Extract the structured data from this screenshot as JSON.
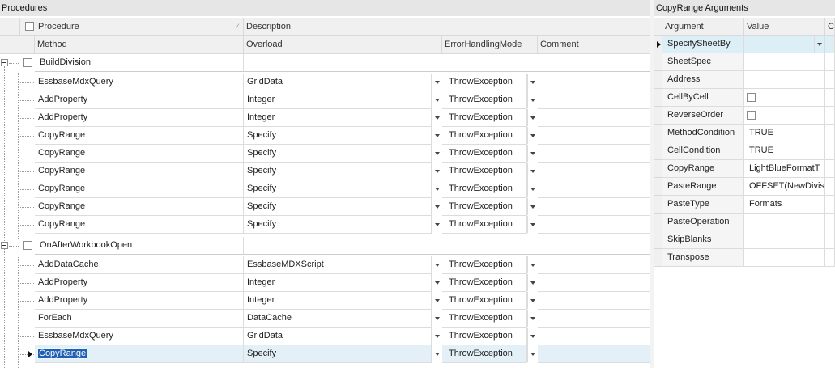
{
  "procedures_panel": {
    "title": "Procedures",
    "header_top": {
      "procedure": "Procedure",
      "description": "Description"
    },
    "header_sub": {
      "method": "Method",
      "overload": "Overload",
      "error_mode": "ErrorHandlingMode",
      "comment": "Comment"
    },
    "groups": [
      {
        "name": "BuildDivision",
        "rows": [
          {
            "method": "EssbaseMdxQuery",
            "overload": "GridData",
            "error": "ThrowException"
          },
          {
            "method": "AddProperty",
            "overload": "Integer",
            "error": "ThrowException"
          },
          {
            "method": "AddProperty",
            "overload": "Integer",
            "error": "ThrowException"
          },
          {
            "method": "CopyRange",
            "overload": "Specify",
            "error": "ThrowException"
          },
          {
            "method": "CopyRange",
            "overload": "Specify",
            "error": "ThrowException"
          },
          {
            "method": "CopyRange",
            "overload": "Specify",
            "error": "ThrowException"
          },
          {
            "method": "CopyRange",
            "overload": "Specify",
            "error": "ThrowException"
          },
          {
            "method": "CopyRange",
            "overload": "Specify",
            "error": "ThrowException"
          },
          {
            "method": "CopyRange",
            "overload": "Specify",
            "error": "ThrowException"
          }
        ]
      },
      {
        "name": "OnAfterWorkbookOpen",
        "rows": [
          {
            "method": "AddDataCache",
            "overload": "EssbaseMDXScript",
            "error": "ThrowException"
          },
          {
            "method": "AddProperty",
            "overload": "Integer",
            "error": "ThrowException"
          },
          {
            "method": "AddProperty",
            "overload": "Integer",
            "error": "ThrowException"
          },
          {
            "method": "ForEach",
            "overload": "DataCache",
            "error": "ThrowException"
          },
          {
            "method": "EssbaseMdxQuery",
            "overload": "GridData",
            "error": "ThrowException"
          },
          {
            "method": "CopyRange",
            "overload": "Specify",
            "error": "ThrowException",
            "selected": true
          }
        ]
      }
    ]
  },
  "arguments_panel": {
    "title": "CopyRange Arguments",
    "headers": {
      "argument": "Argument",
      "value": "Value",
      "comment": "Co"
    },
    "rows": [
      {
        "argument": "SpecifySheetBy",
        "value": "",
        "type": "dropdown",
        "current": true
      },
      {
        "argument": "SheetSpec",
        "value": "",
        "type": "text"
      },
      {
        "argument": "Address",
        "value": "",
        "type": "text"
      },
      {
        "argument": "CellByCell",
        "value": "",
        "type": "checkbox"
      },
      {
        "argument": "ReverseOrder",
        "value": "",
        "type": "checkbox"
      },
      {
        "argument": "MethodCondition",
        "value": "TRUE",
        "type": "text"
      },
      {
        "argument": "CellCondition",
        "value": "TRUE",
        "type": "text"
      },
      {
        "argument": "CopyRange",
        "value": "LightBlueFormatT",
        "type": "text"
      },
      {
        "argument": "PasteRange",
        "value": "OFFSET(NewDivisi",
        "type": "text"
      },
      {
        "argument": "PasteType",
        "value": "Formats",
        "type": "text"
      },
      {
        "argument": "PasteOperation",
        "value": "",
        "type": "text"
      },
      {
        "argument": "SkipBlanks",
        "value": "",
        "type": "text"
      },
      {
        "argument": "Transpose",
        "value": "",
        "type": "text"
      }
    ]
  },
  "colors": {
    "selected_row_bg": "#e3f0f7",
    "current_arg_bg": "#dceef6",
    "selection_blue": "#1f5fb4"
  }
}
